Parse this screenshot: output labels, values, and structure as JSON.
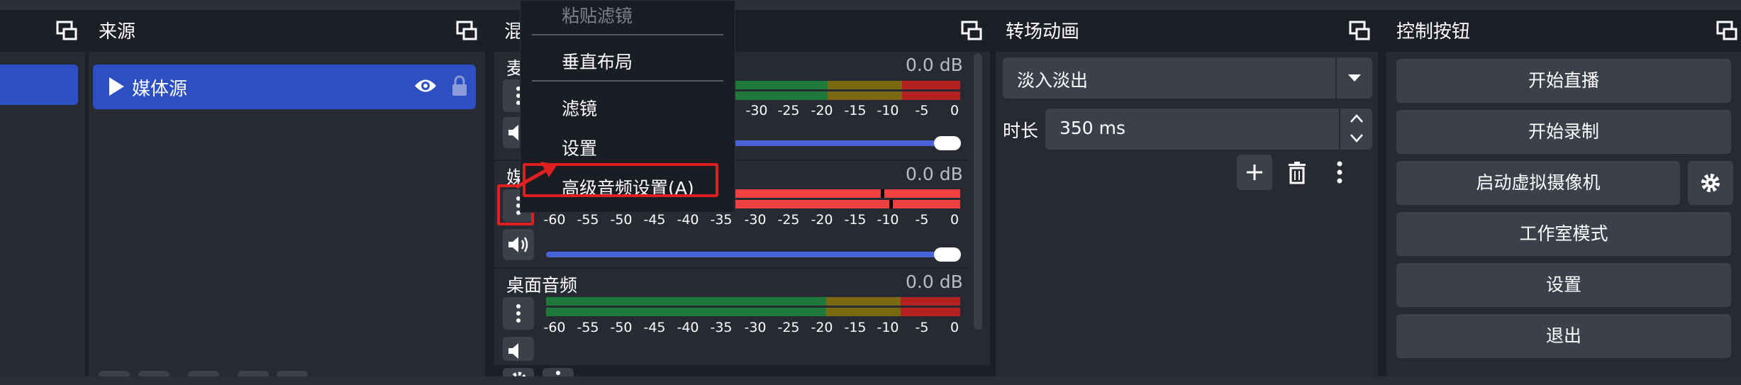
{
  "sources_dock": {
    "title": "来源",
    "items": [
      {
        "label": "媒体源"
      }
    ]
  },
  "mixer_dock": {
    "title_fragment": "混",
    "channels": [
      {
        "label": "麦",
        "db": "0.0 dB"
      },
      {
        "label": "媒",
        "db": "0.0 dB"
      },
      {
        "label": "桌面音频",
        "db": "0.0 dB"
      }
    ],
    "ticks": [
      "-60",
      "-55",
      "-50",
      "-45",
      "-40",
      "-35",
      "-30",
      "-25",
      "-20",
      "-15",
      "-10",
      "-5",
      "0"
    ],
    "partial_ticks": [
      "-30",
      "-25",
      "-20",
      "-15",
      "-10",
      "-5",
      "0"
    ]
  },
  "context_menu": {
    "items": [
      {
        "label": "粘贴滤镜",
        "disabled": true
      },
      {
        "label": "垂直布局"
      },
      {
        "label": "滤镜"
      },
      {
        "label": "设置"
      },
      {
        "label": "高级音频设置(A)",
        "highlighted": true
      }
    ]
  },
  "transitions_dock": {
    "title": "转场动画",
    "transition_select": "淡入淡出",
    "duration_label": "时长",
    "duration_value": "350 ms"
  },
  "controls_dock": {
    "title": "控制按钮",
    "buttons": [
      "开始直播",
      "开始录制",
      "启动虚拟摄像机",
      "工作室模式",
      "设置",
      "退出"
    ]
  },
  "colors": {
    "selected_blue": "#2d4fc4",
    "meter_green": "#1f7a3a",
    "meter_yellow": "#7c6a12",
    "meter_red": "#b3221f",
    "meter_active_red": "#f04040",
    "slider_blue": "#4a62d8",
    "highlight_box": "#e02020"
  },
  "icons": [
    "float-icon",
    "play-icon",
    "eye-icon",
    "lock-icon",
    "kebab-icon",
    "speaker-icon",
    "plus-icon",
    "trash-icon",
    "gear-icon",
    "chevron-up-icon",
    "chevron-down-icon"
  ]
}
